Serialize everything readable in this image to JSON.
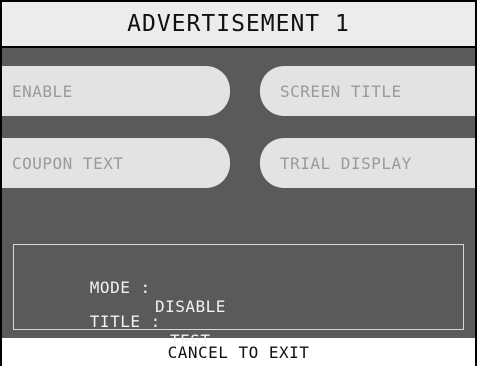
{
  "screen": {
    "title": "ADVERTISEMENT 1",
    "footer": "CANCEL TO EXIT"
  },
  "buttons": {
    "enable": "ENABLE",
    "screen_title": "SCREEN TITLE",
    "coupon_text": "COUPON TEXT",
    "trial_display": "TRIAL DISPLAY"
  },
  "info": {
    "mode_label": "MODE :",
    "mode_value": "DISABLE",
    "title_label": "TITLE :",
    "title_value": "TEST"
  },
  "colors": {
    "panel": "#5a5a5a",
    "button": "#e3e3e3",
    "button_text": "#9a9a9a",
    "title_bar": "#ececec"
  }
}
